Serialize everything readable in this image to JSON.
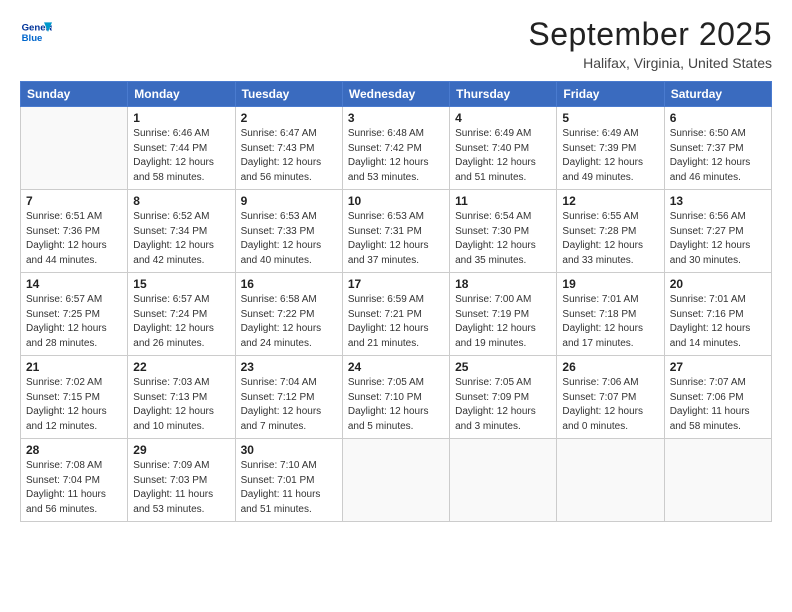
{
  "logo": {
    "line1": "General",
    "line2": "Blue",
    "icon_title": "GeneralBlue Logo"
  },
  "header": {
    "month_year": "September 2025",
    "location": "Halifax, Virginia, United States"
  },
  "days_of_week": [
    "Sunday",
    "Monday",
    "Tuesday",
    "Wednesday",
    "Thursday",
    "Friday",
    "Saturday"
  ],
  "weeks": [
    [
      {
        "day": "",
        "info": ""
      },
      {
        "day": "1",
        "info": "Sunrise: 6:46 AM\nSunset: 7:44 PM\nDaylight: 12 hours\nand 58 minutes."
      },
      {
        "day": "2",
        "info": "Sunrise: 6:47 AM\nSunset: 7:43 PM\nDaylight: 12 hours\nand 56 minutes."
      },
      {
        "day": "3",
        "info": "Sunrise: 6:48 AM\nSunset: 7:42 PM\nDaylight: 12 hours\nand 53 minutes."
      },
      {
        "day": "4",
        "info": "Sunrise: 6:49 AM\nSunset: 7:40 PM\nDaylight: 12 hours\nand 51 minutes."
      },
      {
        "day": "5",
        "info": "Sunrise: 6:49 AM\nSunset: 7:39 PM\nDaylight: 12 hours\nand 49 minutes."
      },
      {
        "day": "6",
        "info": "Sunrise: 6:50 AM\nSunset: 7:37 PM\nDaylight: 12 hours\nand 46 minutes."
      }
    ],
    [
      {
        "day": "7",
        "info": "Sunrise: 6:51 AM\nSunset: 7:36 PM\nDaylight: 12 hours\nand 44 minutes."
      },
      {
        "day": "8",
        "info": "Sunrise: 6:52 AM\nSunset: 7:34 PM\nDaylight: 12 hours\nand 42 minutes."
      },
      {
        "day": "9",
        "info": "Sunrise: 6:53 AM\nSunset: 7:33 PM\nDaylight: 12 hours\nand 40 minutes."
      },
      {
        "day": "10",
        "info": "Sunrise: 6:53 AM\nSunset: 7:31 PM\nDaylight: 12 hours\nand 37 minutes."
      },
      {
        "day": "11",
        "info": "Sunrise: 6:54 AM\nSunset: 7:30 PM\nDaylight: 12 hours\nand 35 minutes."
      },
      {
        "day": "12",
        "info": "Sunrise: 6:55 AM\nSunset: 7:28 PM\nDaylight: 12 hours\nand 33 minutes."
      },
      {
        "day": "13",
        "info": "Sunrise: 6:56 AM\nSunset: 7:27 PM\nDaylight: 12 hours\nand 30 minutes."
      }
    ],
    [
      {
        "day": "14",
        "info": "Sunrise: 6:57 AM\nSunset: 7:25 PM\nDaylight: 12 hours\nand 28 minutes."
      },
      {
        "day": "15",
        "info": "Sunrise: 6:57 AM\nSunset: 7:24 PM\nDaylight: 12 hours\nand 26 minutes."
      },
      {
        "day": "16",
        "info": "Sunrise: 6:58 AM\nSunset: 7:22 PM\nDaylight: 12 hours\nand 24 minutes."
      },
      {
        "day": "17",
        "info": "Sunrise: 6:59 AM\nSunset: 7:21 PM\nDaylight: 12 hours\nand 21 minutes."
      },
      {
        "day": "18",
        "info": "Sunrise: 7:00 AM\nSunset: 7:19 PM\nDaylight: 12 hours\nand 19 minutes."
      },
      {
        "day": "19",
        "info": "Sunrise: 7:01 AM\nSunset: 7:18 PM\nDaylight: 12 hours\nand 17 minutes."
      },
      {
        "day": "20",
        "info": "Sunrise: 7:01 AM\nSunset: 7:16 PM\nDaylight: 12 hours\nand 14 minutes."
      }
    ],
    [
      {
        "day": "21",
        "info": "Sunrise: 7:02 AM\nSunset: 7:15 PM\nDaylight: 12 hours\nand 12 minutes."
      },
      {
        "day": "22",
        "info": "Sunrise: 7:03 AM\nSunset: 7:13 PM\nDaylight: 12 hours\nand 10 minutes."
      },
      {
        "day": "23",
        "info": "Sunrise: 7:04 AM\nSunset: 7:12 PM\nDaylight: 12 hours\nand 7 minutes."
      },
      {
        "day": "24",
        "info": "Sunrise: 7:05 AM\nSunset: 7:10 PM\nDaylight: 12 hours\nand 5 minutes."
      },
      {
        "day": "25",
        "info": "Sunrise: 7:05 AM\nSunset: 7:09 PM\nDaylight: 12 hours\nand 3 minutes."
      },
      {
        "day": "26",
        "info": "Sunrise: 7:06 AM\nSunset: 7:07 PM\nDaylight: 12 hours\nand 0 minutes."
      },
      {
        "day": "27",
        "info": "Sunrise: 7:07 AM\nSunset: 7:06 PM\nDaylight: 11 hours\nand 58 minutes."
      }
    ],
    [
      {
        "day": "28",
        "info": "Sunrise: 7:08 AM\nSunset: 7:04 PM\nDaylight: 11 hours\nand 56 minutes."
      },
      {
        "day": "29",
        "info": "Sunrise: 7:09 AM\nSunset: 7:03 PM\nDaylight: 11 hours\nand 53 minutes."
      },
      {
        "day": "30",
        "info": "Sunrise: 7:10 AM\nSunset: 7:01 PM\nDaylight: 11 hours\nand 51 minutes."
      },
      {
        "day": "",
        "info": ""
      },
      {
        "day": "",
        "info": ""
      },
      {
        "day": "",
        "info": ""
      },
      {
        "day": "",
        "info": ""
      }
    ]
  ]
}
